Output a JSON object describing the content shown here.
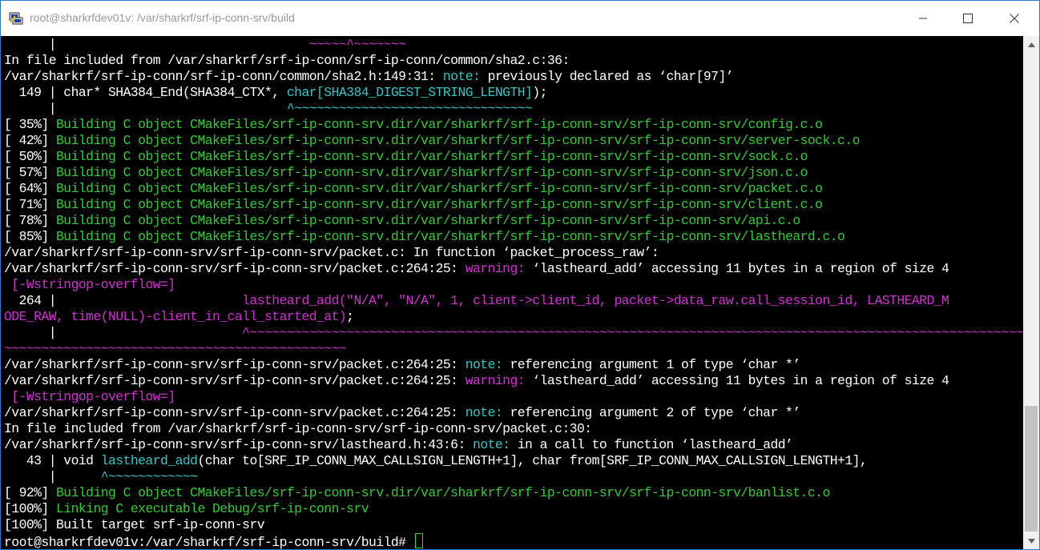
{
  "window": {
    "title": "root@sharkrfdev01v: /var/sharkrf/srf-ip-conn-srv/build",
    "icons": {
      "app": "putty-icon",
      "minimize": "minimize-icon",
      "maximize": "maximize-icon",
      "close": "close-icon"
    }
  },
  "terminal": {
    "lines": [
      [
        [
          "w",
          "      |                                  "
        ],
        [
          "m",
          "~~~~~^~~~~~~~"
        ]
      ],
      [
        [
          "w",
          "In file included from /var/sharkrf/srf-ip-conn/srf-ip-conn/common/sha2.c:36:"
        ]
      ],
      [
        [
          "w",
          "/var/sharkrf/srf-ip-conn/srf-ip-conn/common/sha2.h:149:31: "
        ],
        [
          "c",
          "note:"
        ],
        [
          "w",
          " previously declared as ‘char[97]’"
        ]
      ],
      [
        [
          "w",
          "  149 | char* SHA384_End(SHA384_CTX*, "
        ],
        [
          "c",
          "char[SHA384_DIGEST_STRING_LENGTH]"
        ],
        [
          "w",
          ");"
        ]
      ],
      [
        [
          "w",
          "      |                               "
        ],
        [
          "c",
          "^~~~~~~~~~~~~~~~~~~~~~~~~~~~~~~~~"
        ]
      ],
      [
        [
          "w",
          "[ 35%] "
        ],
        [
          "g",
          "Building C object CMakeFiles/srf-ip-conn-srv.dir/var/sharkrf/srf-ip-conn-srv/srf-ip-conn-srv/config.c.o"
        ]
      ],
      [
        [
          "w",
          "[ 42%] "
        ],
        [
          "g",
          "Building C object CMakeFiles/srf-ip-conn-srv.dir/var/sharkrf/srf-ip-conn-srv/srf-ip-conn-srv/server-sock.c.o"
        ]
      ],
      [
        [
          "w",
          "[ 50%] "
        ],
        [
          "g",
          "Building C object CMakeFiles/srf-ip-conn-srv.dir/var/sharkrf/srf-ip-conn-srv/srf-ip-conn-srv/sock.c.o"
        ]
      ],
      [
        [
          "w",
          "[ 57%] "
        ],
        [
          "g",
          "Building C object CMakeFiles/srf-ip-conn-srv.dir/var/sharkrf/srf-ip-conn-srv/srf-ip-conn-srv/json.c.o"
        ]
      ],
      [
        [
          "w",
          "[ 64%] "
        ],
        [
          "g",
          "Building C object CMakeFiles/srf-ip-conn-srv.dir/var/sharkrf/srf-ip-conn-srv/srf-ip-conn-srv/packet.c.o"
        ]
      ],
      [
        [
          "w",
          "[ 71%] "
        ],
        [
          "g",
          "Building C object CMakeFiles/srf-ip-conn-srv.dir/var/sharkrf/srf-ip-conn-srv/srf-ip-conn-srv/client.c.o"
        ]
      ],
      [
        [
          "w",
          "[ 78%] "
        ],
        [
          "g",
          "Building C object CMakeFiles/srf-ip-conn-srv.dir/var/sharkrf/srf-ip-conn-srv/srf-ip-conn-srv/api.c.o"
        ]
      ],
      [
        [
          "w",
          "[ 85%] "
        ],
        [
          "g",
          "Building C object CMakeFiles/srf-ip-conn-srv.dir/var/sharkrf/srf-ip-conn-srv/srf-ip-conn-srv/lastheard.c.o"
        ]
      ],
      [
        [
          "w",
          "/var/sharkrf/srf-ip-conn-srv/srf-ip-conn-srv/packet.c: In function ‘packet_process_raw’:"
        ]
      ],
      [
        [
          "w",
          "/var/sharkrf/srf-ip-conn-srv/srf-ip-conn-srv/packet.c:264:25: "
        ],
        [
          "m",
          "warning:"
        ],
        [
          "w",
          " ‘lastheard_add’ accessing 11 bytes in a region of size 4"
        ]
      ],
      [
        [
          "w",
          " "
        ],
        [
          "m",
          "[-Wstringop-overflow=]"
        ]
      ],
      [
        [
          "w",
          "  264 |                         "
        ],
        [
          "m",
          "lastheard_add(\"N/A\", \"N/A\", 1, client->client_id, packet->data_raw.call_session_id, LASTHEARD_M"
        ]
      ],
      [
        [
          "m",
          "ODE_RAW, time(NULL)-client_in_call_started_at)"
        ],
        [
          "w",
          ";"
        ]
      ],
      [
        [
          "w",
          "      |                         "
        ],
        [
          "m",
          "^~~~~~~~~~~~~~~~~~~~~~~~~~~~~~~~~~~~~~~~~~~~~~~~~~~~~~~~~~~~~~~~~~~~~~~~~~~~~~~~~~~~~~~~~~~~~~~~~~~~~~~~~~~~"
        ]
      ],
      [
        [
          "m",
          "~~~~~~~~~~~~~~~~~~~~~~~~~~~~~~~~~~~~~~~~~~~~~~"
        ]
      ],
      [
        [
          "w",
          "/var/sharkrf/srf-ip-conn-srv/srf-ip-conn-srv/packet.c:264:25: "
        ],
        [
          "c",
          "note:"
        ],
        [
          "w",
          " referencing argument 1 of type ‘char *’"
        ]
      ],
      [
        [
          "w",
          "/var/sharkrf/srf-ip-conn-srv/srf-ip-conn-srv/packet.c:264:25: "
        ],
        [
          "m",
          "warning:"
        ],
        [
          "w",
          " ‘lastheard_add’ accessing 11 bytes in a region of size 4"
        ]
      ],
      [
        [
          "w",
          " "
        ],
        [
          "m",
          "[-Wstringop-overflow=]"
        ]
      ],
      [
        [
          "w",
          "/var/sharkrf/srf-ip-conn-srv/srf-ip-conn-srv/packet.c:264:25: "
        ],
        [
          "c",
          "note:"
        ],
        [
          "w",
          " referencing argument 2 of type ‘char *’"
        ]
      ],
      [
        [
          "w",
          "In file included from /var/sharkrf/srf-ip-conn-srv/srf-ip-conn-srv/packet.c:30:"
        ]
      ],
      [
        [
          "w",
          "/var/sharkrf/srf-ip-conn-srv/srf-ip-conn-srv/lastheard.h:43:6: "
        ],
        [
          "c",
          "note:"
        ],
        [
          "w",
          " in a call to function ‘lastheard_add’"
        ]
      ],
      [
        [
          "w",
          "   43 | void "
        ],
        [
          "c",
          "lastheard_add"
        ],
        [
          "w",
          "(char to[SRF_IP_CONN_MAX_CALLSIGN_LENGTH+1], char from[SRF_IP_CONN_MAX_CALLSIGN_LENGTH+1],"
        ]
      ],
      [
        [
          "w",
          "      |      "
        ],
        [
          "c",
          "^~~~~~~~~~~~~"
        ]
      ],
      [
        [
          "w",
          "[ 92%] "
        ],
        [
          "g",
          "Building C object CMakeFiles/srf-ip-conn-srv.dir/var/sharkrf/srf-ip-conn-srv/srf-ip-conn-srv/banlist.c.o"
        ]
      ],
      [
        [
          "w",
          "[100%] "
        ],
        [
          "g",
          "Linking C executable Debug/srf-ip-conn-srv"
        ]
      ],
      [
        [
          "w",
          "[100%] Built target srf-ip-conn-srv"
        ]
      ],
      [
        [
          "w",
          "root@sharkrfdev01v:/var/sharkrf/srf-ip-conn-srv/build# "
        ]
      ]
    ]
  },
  "scrollbar": {
    "icons": {
      "up": "scroll-up-arrow-icon",
      "down": "scroll-down-arrow-icon"
    }
  }
}
